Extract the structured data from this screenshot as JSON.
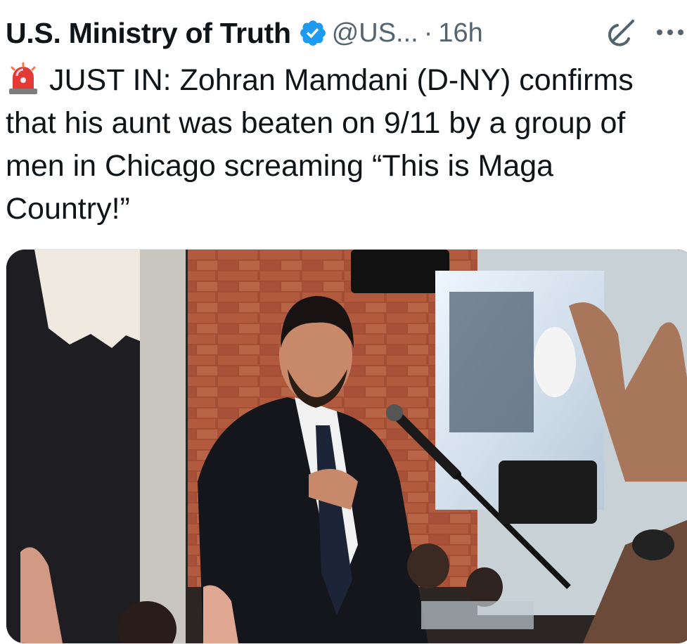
{
  "post": {
    "author_name": "U.S. Ministry of Truth",
    "handle": "@US...",
    "separator": "·",
    "time": "16h",
    "icons": [
      "verified-badge-icon",
      "grok-icon",
      "more-icon",
      "siren-icon"
    ],
    "text": "JUST IN: Zohran Mamdani (D-NY) confirms that his aunt was beaten on 9/11 by a group of men in Chicago screaming “This is Maga Country!”",
    "colors": {
      "verified": "#1d9bf0",
      "secondary_text": "#536471",
      "text": "#0f1419"
    }
  }
}
